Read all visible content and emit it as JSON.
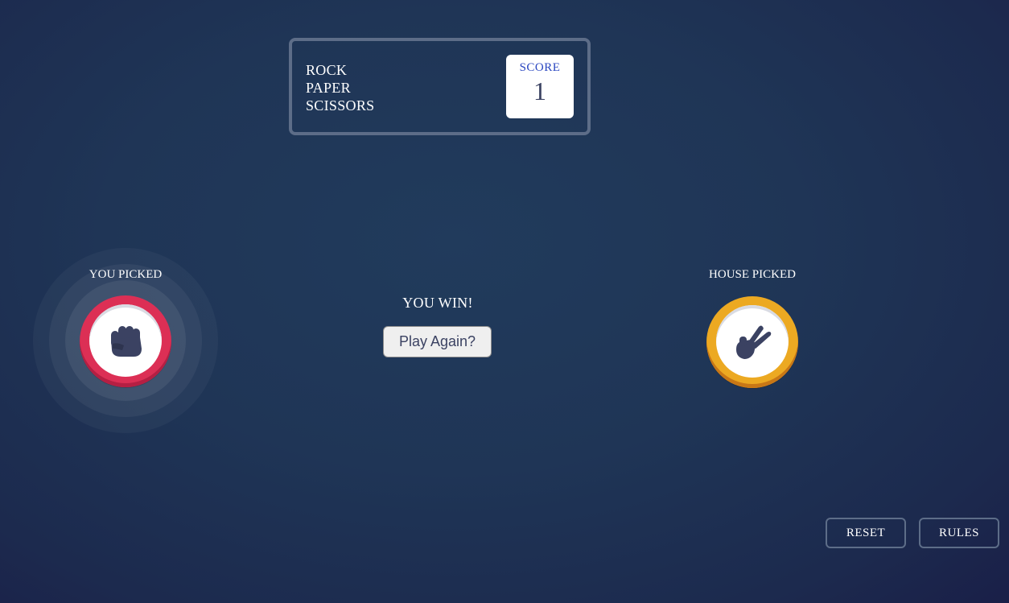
{
  "header": {
    "title_lines": [
      "ROCK",
      "PAPER",
      "SCISSORS"
    ],
    "score_label": "SCORE",
    "score_value": "1"
  },
  "player": {
    "label": "YOU PICKED",
    "choice_icon": "rock-fist-icon",
    "accent": "#dc2f55"
  },
  "house": {
    "label": "HOUSE PICKED",
    "choice_icon": "scissors-hand-icon",
    "accent": "#eca922"
  },
  "result": {
    "message": "YOU WIN!",
    "play_again_label": "Play Again?"
  },
  "footer": {
    "reset_label": "RESET",
    "rules_label": "RULES"
  },
  "colors": {
    "icon": "#3b4262",
    "border": "#5d6d88",
    "score_label": "#2a46c0"
  }
}
